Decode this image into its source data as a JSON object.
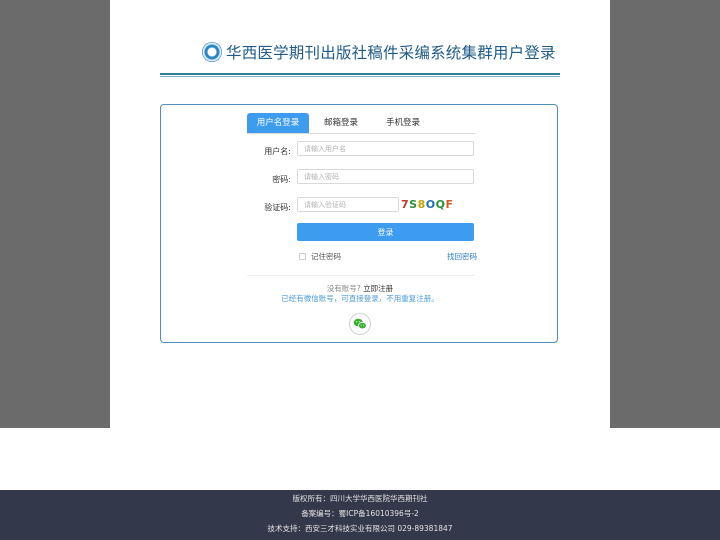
{
  "header": {
    "title": "华西医学期刊出版社稿件采编系统集群用户登录",
    "logo_icon": "journal-seal-logo"
  },
  "tabs": [
    {
      "label": "用户名登录",
      "active": true
    },
    {
      "label": "邮箱登录",
      "active": false
    },
    {
      "label": "手机登录",
      "active": false
    }
  ],
  "form": {
    "username_label": "用户名:",
    "username_placeholder": "请输入用户名",
    "password_label": "密码:",
    "password_placeholder": "请输入密码",
    "captcha_label": "验证码:",
    "captcha_placeholder": "请输入验证码",
    "captcha_chars": [
      "7",
      "S",
      "8",
      "O",
      "Q",
      "F"
    ],
    "captcha_colors": [
      "#c0392b",
      "#2a8f3a",
      "#c8a000",
      "#1f6fb5",
      "#2a8f3a",
      "#d65a2a"
    ],
    "login_button": "登录",
    "remember_label": "记住密码",
    "remember_checked": false,
    "forgot_link": "找回密码"
  },
  "register": {
    "prompt": "没有账号?",
    "link": "立即注册",
    "wechat_note": "已经有微信账号，可直接登录，不用重复注册。",
    "wechat_icon": "wechat-icon"
  },
  "footer": {
    "copyright": "版权所有：四川大学华西医院华西期刊社",
    "icp": "备案编号：蜀ICP备16010396号-2",
    "support": "技术支持：西安三才科技实业有限公司 029-89381847"
  },
  "colors": {
    "accent": "#3d9bf0",
    "title": "#1f5b86",
    "footer_bg": "#33384a",
    "page_bg": "#6b6b6b"
  }
}
